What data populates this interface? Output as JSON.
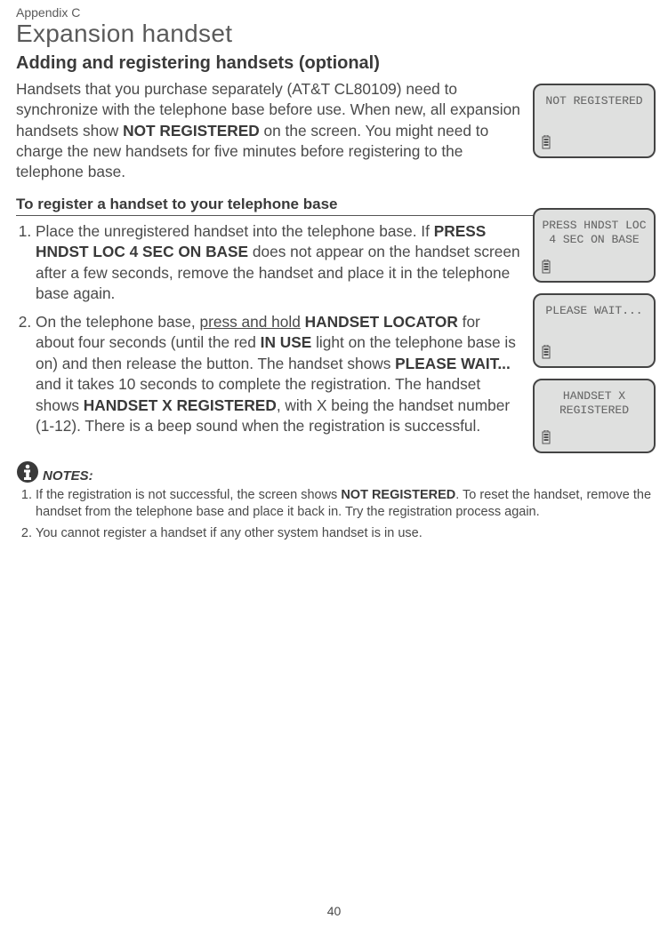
{
  "appendix": "Appendix C",
  "chapter_title": "Expansion handset",
  "section_title": "Adding and registering handsets (optional)",
  "intro_pre": "Handsets that you purchase separately (AT&T CL80109) need to synchronize with the telephone base before use. When new, all expansion handsets show ",
  "intro_bold": "NOT REGISTERED",
  "intro_post": " on the screen. You might need to charge the new handsets for five minutes before registering to the telephone base.",
  "subsection_title": "To register a handset to your telephone base",
  "step1_a": "Place the unregistered handset into the telephone base. If ",
  "step1_b": "PRESS HNDST LOC 4 SEC ON BASE",
  "step1_c": " does not appear on the handset screen after a few seconds, remove the handset and place it in the telephone base again.",
  "step2_a": "On the telephone base, ",
  "step2_u": "press and hold",
  "step2_b": " ",
  "step2_bold1": "HANDSET LOCATOR",
  "step2_c": " for about four seconds (until the red ",
  "step2_bold2": "IN USE",
  "step2_d": " light on the telephone base is on) and then release the button. The handset shows ",
  "step2_bold3": "PLEASE WAIT...",
  "step2_e": " and it takes 10 seconds to complete the registration. The handset shows ",
  "step2_bold4": "HANDSET X REGISTERED",
  "step2_f": ", with X being the handset number (1-12). There is a beep sound when the registration is successful.",
  "notes_label": "NOTES:",
  "note1_a": "If the registration is not successful, the screen shows ",
  "note1_b": "NOT REGISTERED",
  "note1_c": ". To reset the handset, remove the handset from the telephone base and place it back in. Try the registration process again.",
  "note2": "You cannot register a handset if any other system handset is in use.",
  "page_number": "40",
  "screens": {
    "s1_l1": "NOT REGISTERED",
    "s2_l1": "PRESS HNDST LOC",
    "s2_l2": "4 SEC ON BASE",
    "s3_l1": "PLEASE WAIT...",
    "s4_l1": "HANDSET X",
    "s4_l2": "REGISTERED"
  }
}
